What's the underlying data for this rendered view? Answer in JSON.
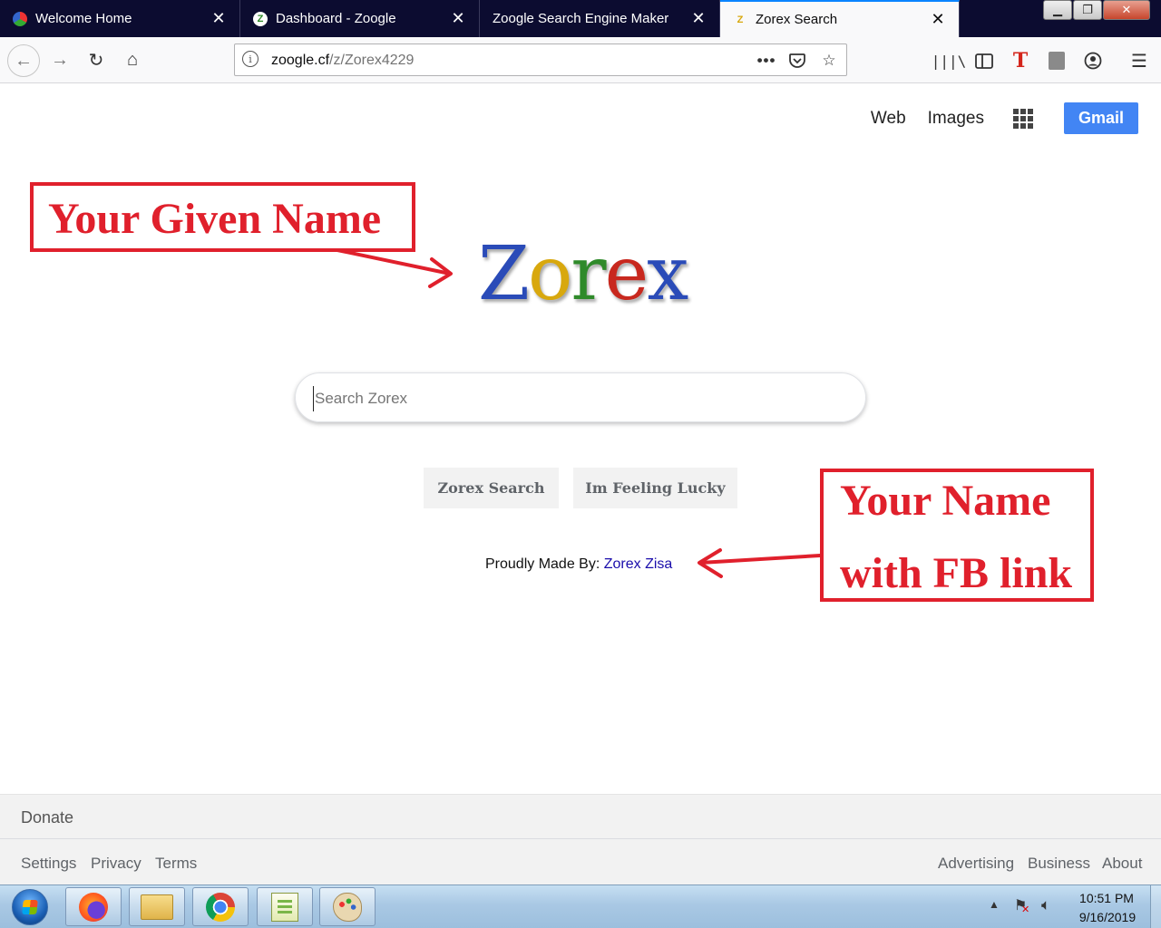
{
  "browser": {
    "tabs": [
      {
        "label": "Welcome Home",
        "active": false
      },
      {
        "label": "Dashboard - Zoogle",
        "active": false
      },
      {
        "label": "Zoogle Search Engine Maker",
        "active": false
      },
      {
        "label": "Zorex Search",
        "active": true
      }
    ],
    "tab_close_glyph": "✕",
    "url_host": "zoogle.cf",
    "url_path": "/z/Zorex4229",
    "accent_color": "#0a84ff"
  },
  "page": {
    "topnav": {
      "web": "Web",
      "images": "Images",
      "gmail": "Gmail"
    },
    "logo": {
      "letters": [
        "Z",
        "o",
        "r",
        "e",
        "x"
      ]
    },
    "search": {
      "placeholder": "Search Zorex",
      "value": ""
    },
    "buttons": {
      "search": "Zorex Search",
      "lucky": "Im Feeling Lucky"
    },
    "credit": {
      "prefix": "Proudly Made By:",
      "link": "Zorex Zisa"
    },
    "annotations": {
      "given_name": "Your Given Name",
      "fb_line1": "Your Name",
      "fb_line2": "with FB link",
      "color": "#e0202c"
    },
    "footer": {
      "donate": "Donate",
      "left_links": [
        "Settings",
        "Privacy",
        "Terms"
      ],
      "right_links": [
        "Advertising",
        "Business",
        "About"
      ]
    }
  },
  "taskbar": {
    "apps": [
      "firefox-icon",
      "file-explorer-icon",
      "chrome-icon",
      "notepad-icon",
      "paint-icon"
    ],
    "time": "10:51 PM",
    "date": "9/16/2019"
  }
}
